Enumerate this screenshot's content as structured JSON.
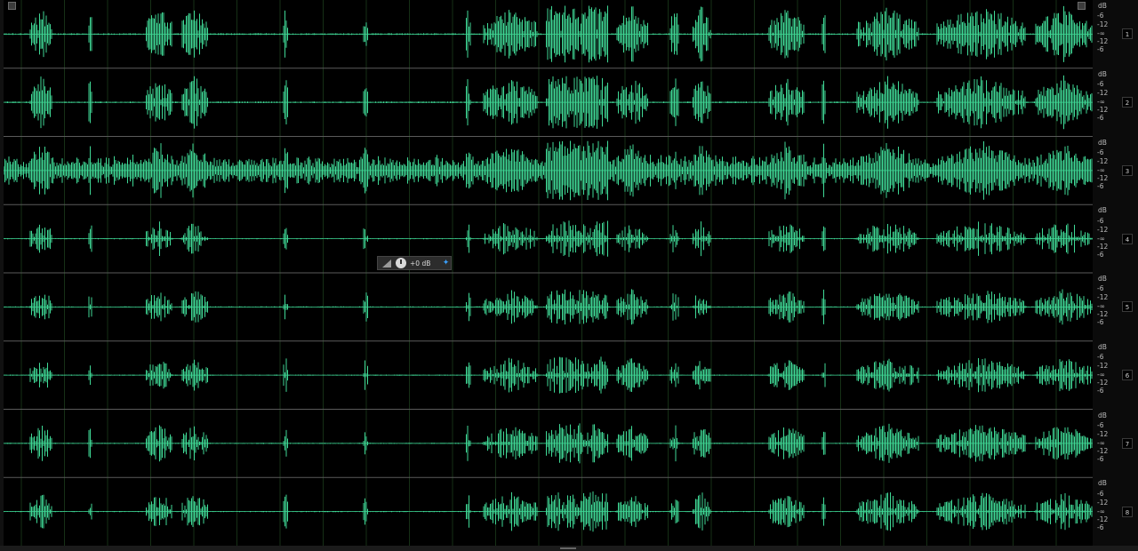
{
  "window": {
    "title": ""
  },
  "colors": {
    "background": "#000000",
    "waveform": "#3fd996",
    "grid": "#163016",
    "divider": "#5a5a5a",
    "ruler_bg": "#0b0b0b",
    "accent": "#3aa0ff"
  },
  "amplitude_ruler": {
    "unit": "dB",
    "ticks": [
      "-6",
      "-12",
      "-∞",
      "-12",
      "-6"
    ]
  },
  "channels": [
    {
      "number": "1",
      "level": 0.85,
      "density": 0.55
    },
    {
      "number": "2",
      "level": 0.8,
      "density": 0.55
    },
    {
      "number": "3",
      "level": 0.9,
      "density": 0.95
    },
    {
      "number": "4",
      "level": 0.55,
      "density": 0.25
    },
    {
      "number": "5",
      "level": 0.55,
      "density": 0.4
    },
    {
      "number": "6",
      "level": 0.55,
      "density": 0.4
    },
    {
      "number": "7",
      "level": 0.6,
      "density": 0.45
    },
    {
      "number": "8",
      "level": 0.6,
      "density": 0.45
    }
  ],
  "hud": {
    "volume_label": "+0 dB",
    "icons": [
      "fade-ramp-icon",
      "volume-knob-icon",
      "pin-icon"
    ]
  },
  "icons": {
    "top_left": "zoom-corner-icon",
    "top_right": "zoom-corner-icon"
  }
}
